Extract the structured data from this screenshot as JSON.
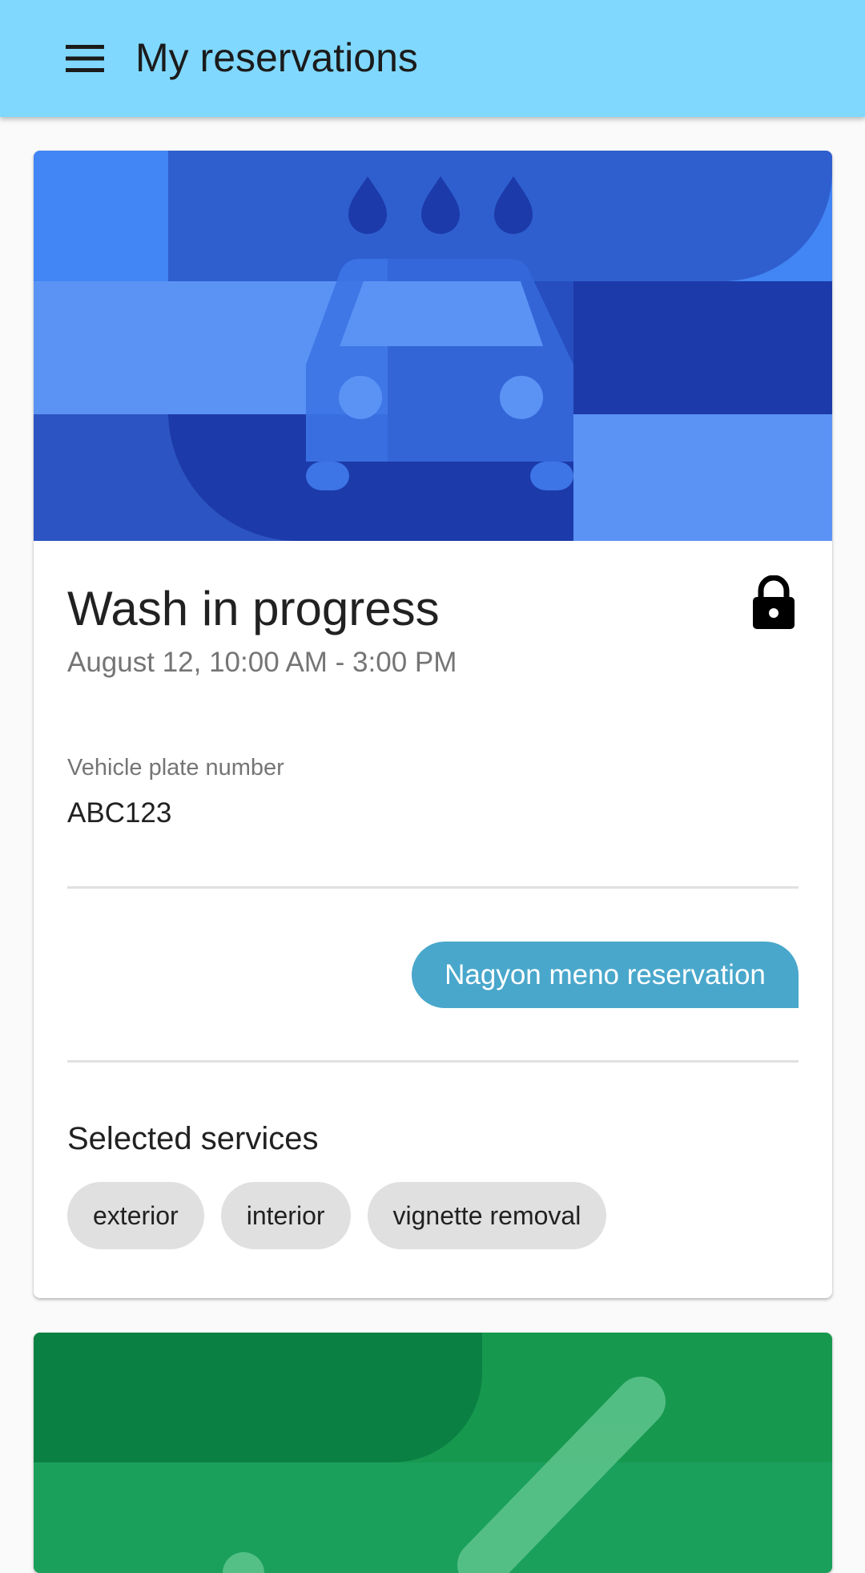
{
  "app_bar": {
    "title": "My reservations",
    "menu_icon": "menu-icon",
    "color": "#80d8ff"
  },
  "reservations": [
    {
      "hero_icon": "car-wash-icon",
      "status_title": "Wash in progress",
      "status_icon": "lock-icon",
      "time_range": "August 12, 10:00 AM - 3:00 PM",
      "plate_label": "Vehicle plate number",
      "plate_value": "ABC123",
      "action_label": "Nagyon meno reservation",
      "services_title": "Selected services",
      "services": [
        "exterior",
        "interior",
        "vignette removal"
      ],
      "colors": {
        "hero": "#1c3aa9",
        "action": "#49a7cb",
        "chip": "#e0e0e0"
      }
    },
    {
      "hero_icon": "pen-icon",
      "colors": {
        "hero": "#179b57"
      }
    }
  ]
}
